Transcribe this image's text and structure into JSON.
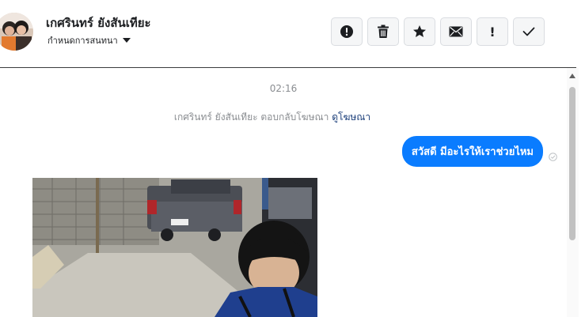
{
  "header": {
    "contact_name": "เกศรินทร์ ยังสันเทียะ",
    "assign_label": "กำหนดการสนทนา",
    "actions": [
      {
        "name": "spam-button",
        "icon": "exclamation-circle-icon"
      },
      {
        "name": "delete-button",
        "icon": "trash-icon"
      },
      {
        "name": "star-button",
        "icon": "star-icon"
      },
      {
        "name": "mark-unread-button",
        "icon": "envelope-icon"
      },
      {
        "name": "follow-up-button",
        "icon": "exclamation-icon",
        "glyph": "!"
      },
      {
        "name": "mark-done-button",
        "icon": "checkmark-icon"
      }
    ]
  },
  "thread": {
    "timestamp": "02:16",
    "ad_reply_text": "เกศรินทร์ ยังสันเทียะ ตอบกลับโฆษณา",
    "ad_link": "ดูโฆษณา",
    "outgoing_message": "สวัสดี มีอะไรให้เราช่วยไหม",
    "bubble_color": "#0a7cff"
  }
}
